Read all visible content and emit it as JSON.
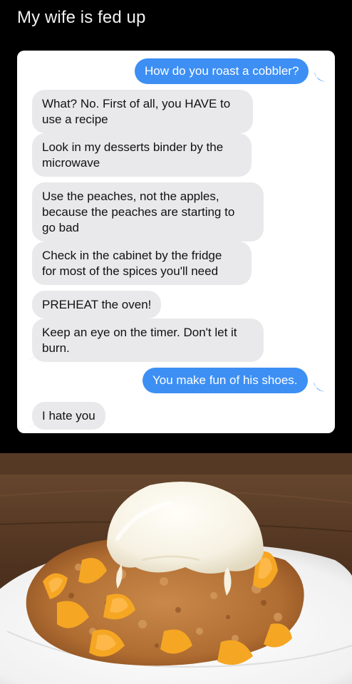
{
  "title": "My wife is fed up",
  "messages": [
    {
      "direction": "out",
      "text": "How do you roast a cobbler?"
    },
    {
      "direction": "in",
      "text": "What? No. First of all, you HAVE to\nuse a recipe"
    },
    {
      "direction": "in",
      "text": "Look in my desserts binder by the\nmicrowave"
    },
    {
      "direction": "in",
      "text": "Use the peaches, not the apples,\nbecause the peaches are starting to\ngo bad"
    },
    {
      "direction": "in",
      "text": "Check in the cabinet by the fridge\nfor most of the spices you'll need"
    },
    {
      "direction": "in",
      "text": "PREHEAT the oven!"
    },
    {
      "direction": "in",
      "text": "Keep an eye on the timer. Don't let it\nburn."
    },
    {
      "direction": "out",
      "text": "You make fun of his shoes."
    },
    {
      "direction": "in",
      "text": "I hate you"
    }
  ],
  "colors": {
    "outgoing_bubble": "#3d8ff4",
    "incoming_bubble": "#e9e9eb",
    "background": "#000000"
  },
  "photo": {
    "subject": "peach-cobbler-with-ice-cream-icon"
  }
}
